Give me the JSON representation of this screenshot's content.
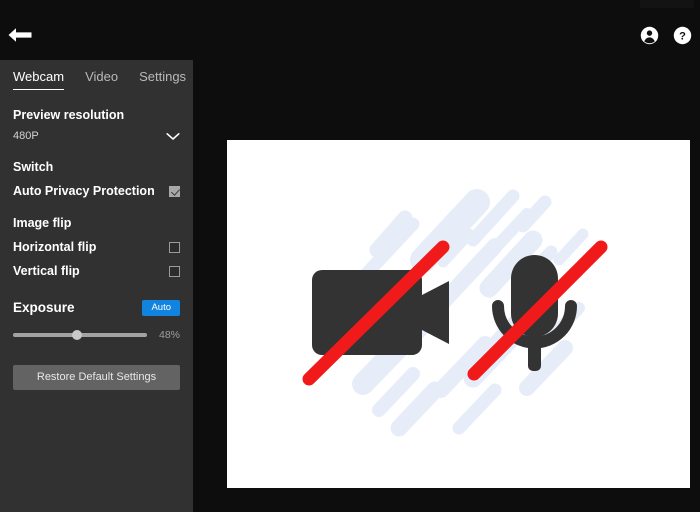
{
  "window": {
    "title_bar_visible": true,
    "background_color": "#0d0d0d"
  },
  "topbar": {
    "back_icon": "arrow-left-icon",
    "account_icon": "account-circle-icon",
    "help_icon": "help-circle-icon"
  },
  "sidebar": {
    "background_color": "#313131",
    "tabs": [
      {
        "label": "Webcam",
        "active": true
      },
      {
        "label": "Video",
        "active": false
      },
      {
        "label": "Settings",
        "active": false
      }
    ],
    "preview_resolution": {
      "heading": "Preview resolution",
      "value": "480P",
      "chevron_icon": "chevron-down-icon"
    },
    "switch": {
      "heading": "Switch",
      "options": [
        {
          "label": "Auto Privacy Protection",
          "checked": true
        }
      ]
    },
    "image_flip": {
      "heading": "Image flip",
      "options": [
        {
          "label": "Horizontal flip",
          "checked": false
        },
        {
          "label": "Vertical flip",
          "checked": false
        }
      ]
    },
    "exposure": {
      "heading": "Exposure",
      "auto_label": "Auto",
      "auto_badge_color": "#1184e0",
      "value_label": "48%",
      "value_percent": 48
    },
    "restore_button": "Restore Default Settings"
  },
  "preview": {
    "background_color": "#ffffff",
    "camera_icon": "camera-off-icon",
    "microphone_icon": "microphone-off-icon",
    "slash_color": "#f01a1a",
    "icon_color": "#333333",
    "streak_color": "#e6edf9"
  }
}
